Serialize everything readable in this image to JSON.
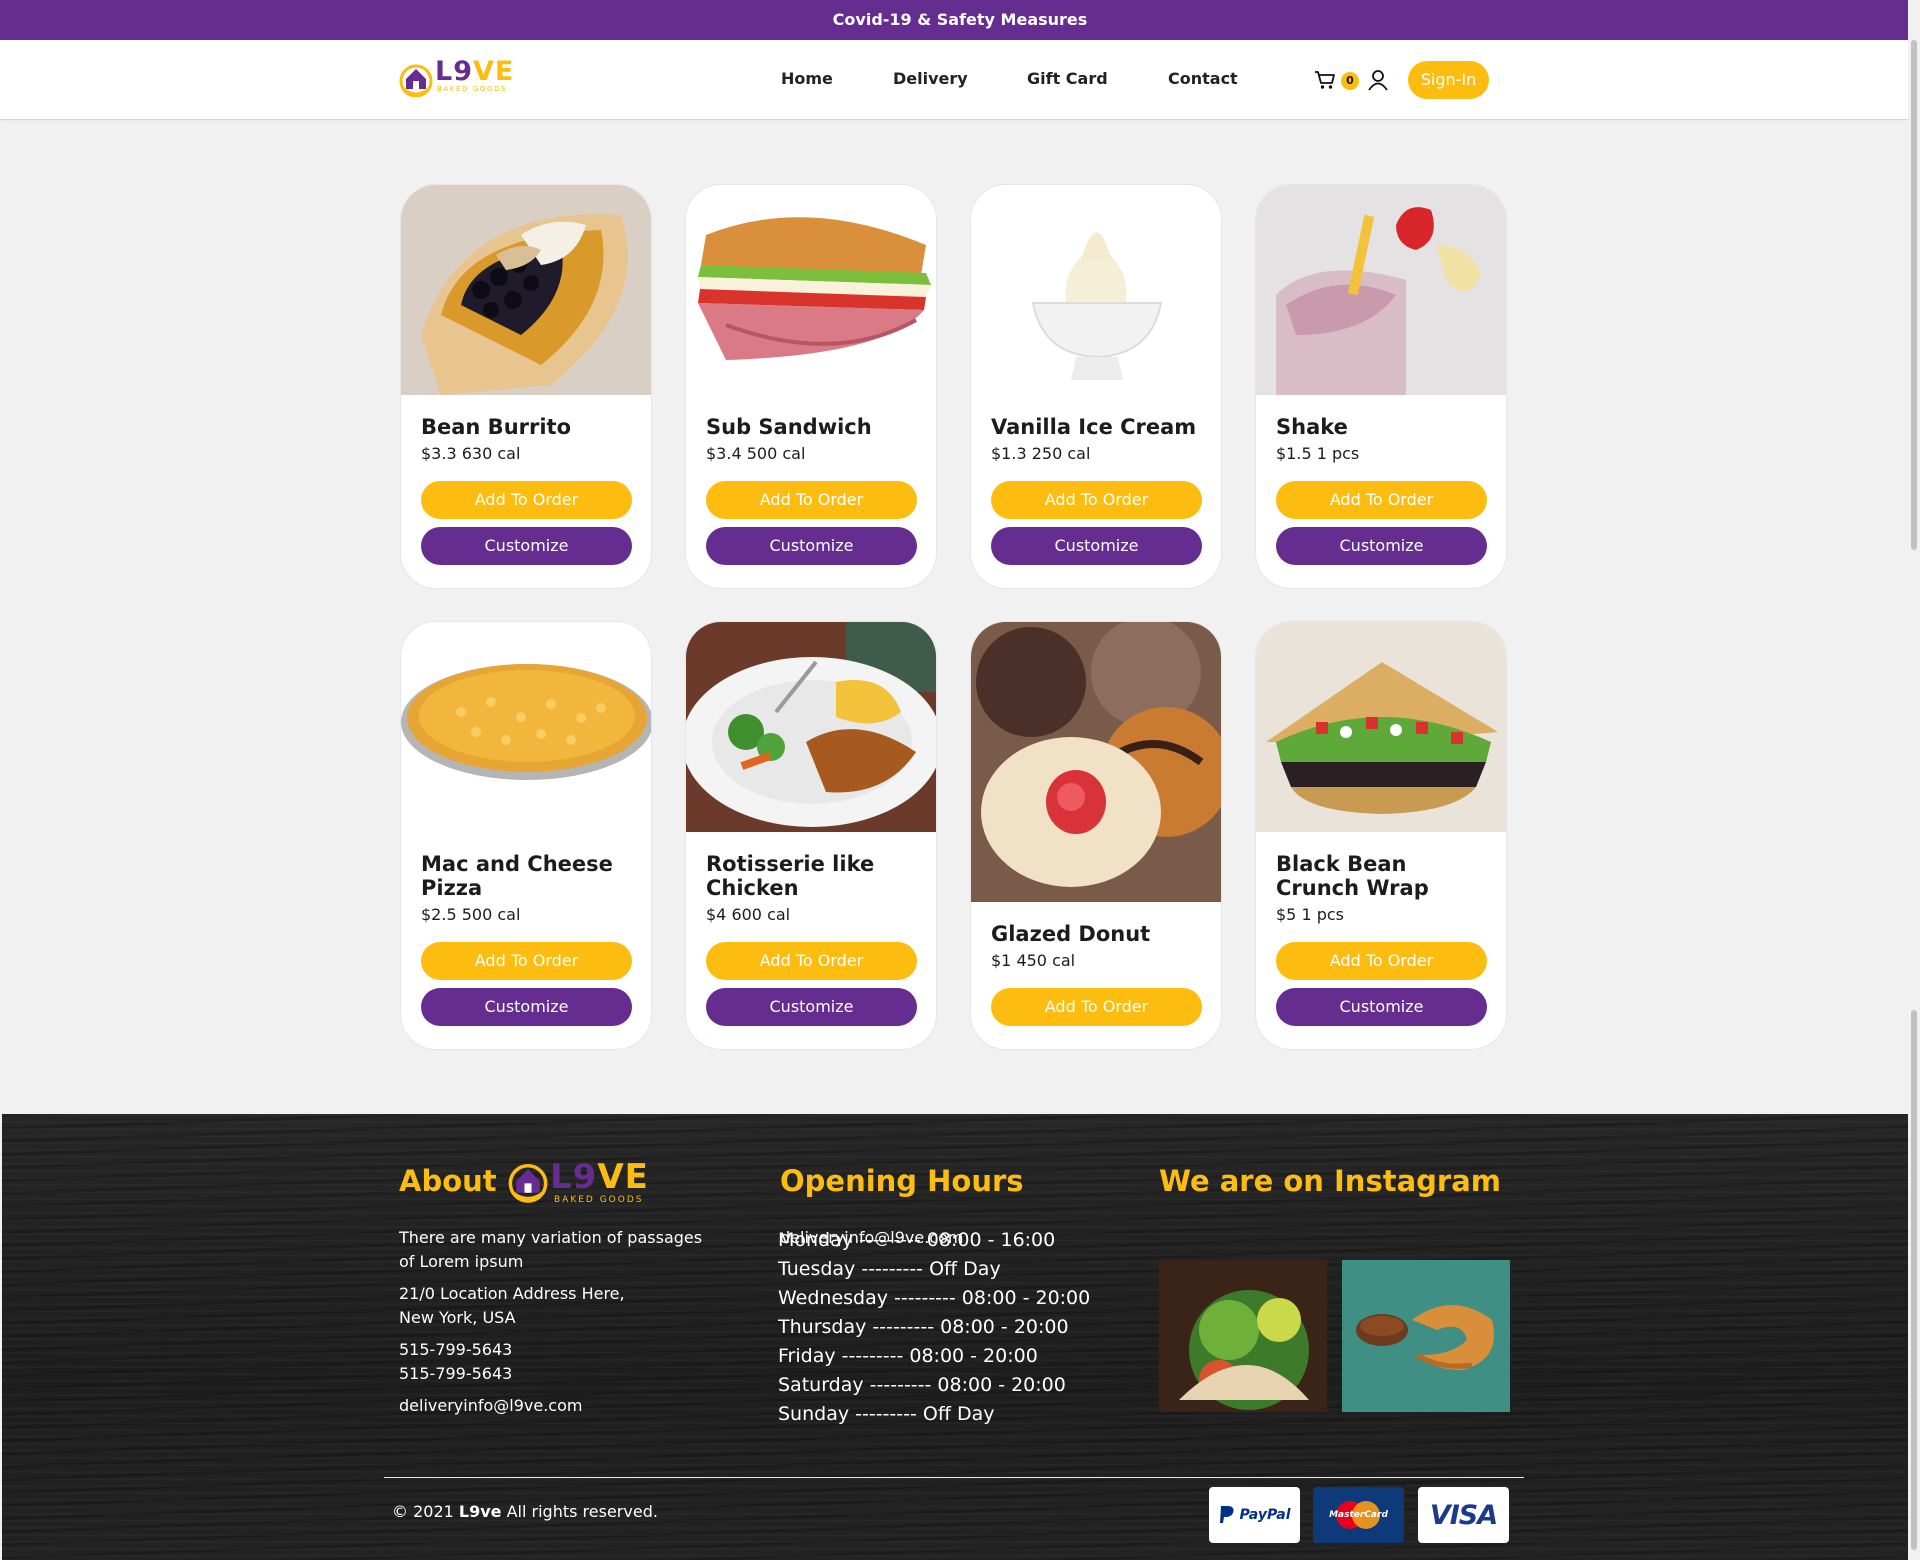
{
  "banner": {
    "text": "Covid-19 & Safety Measures"
  },
  "header": {
    "logo_word_main": "L9",
    "logo_word_accent": "VE",
    "logo_sub": "BAKED GOODS",
    "nav": [
      "Home",
      "Delivery",
      "Gift Card",
      "Contact"
    ],
    "cart_count": "0",
    "signin_label": "Sign-In",
    "icons": [
      "cart-icon",
      "user-icon"
    ]
  },
  "products": [
    {
      "name": "Bean Burrito",
      "meta": "$3.3 630 cal",
      "add": "Add To Order",
      "customize": "Customize"
    },
    {
      "name": "Sub Sandwich",
      "meta": "$3.4 500 cal",
      "add": "Add To Order",
      "customize": "Customize"
    },
    {
      "name": "Vanilla Ice Cream",
      "meta": "$1.3 250 cal",
      "add": "Add To Order",
      "customize": "Customize"
    },
    {
      "name": "Shake",
      "meta": "$1.5 1 pcs",
      "add": "Add To Order",
      "customize": "Customize"
    },
    {
      "name": "Mac and Cheese Pizza",
      "meta": "$2.5 500 cal",
      "add": "Add To Order",
      "customize": "Customize"
    },
    {
      "name": "Rotisserie like Chicken",
      "meta": "$4 600 cal",
      "add": "Add To Order",
      "customize": "Customize"
    },
    {
      "name": "Glazed Donut",
      "meta": "$1 450 cal",
      "add": "Add To Order"
    },
    {
      "name": "Black Bean Crunch Wrap",
      "meta": "$5 1 pcs",
      "add": "Add To Order",
      "customize": "Customize"
    }
  ],
  "footer": {
    "about_title": "About",
    "about_text_1": "There are many variation of passages",
    "about_text_2": "of Lorem ipsum",
    "address_1": "21/0 Location Address Here,",
    "address_2": "New York, USA",
    "phone_1": "515-799-5643",
    "phone_2": "515-799-5643",
    "email": "deliveryinfo@l9ve.com",
    "hours_title": "Opening Hours",
    "hours_email": "deliveryinfo@l9ve.com",
    "hours": [
      "Monday --------- 08:00 - 16:00",
      "Tuesday --------- Off Day",
      "Wednesday --------- 08:00 - 20:00",
      "Thursday --------- 08:00 - 20:00",
      "Friday --------- 08:00 - 20:00",
      "Saturday --------- 08:00 - 20:00",
      "Sunday --------- Off Day"
    ],
    "instagram_title": "We are on Instagram",
    "copyright_prefix": "© 2021",
    "copyright_brand": "L9ve",
    "copyright_suffix": "All rights reserved.",
    "payments": [
      "PayPal",
      "MasterCard",
      "VISA"
    ]
  },
  "colors": {
    "purple": "#662d91",
    "yellow": "#fdbd10",
    "page_bg": "#f1f1f1"
  }
}
